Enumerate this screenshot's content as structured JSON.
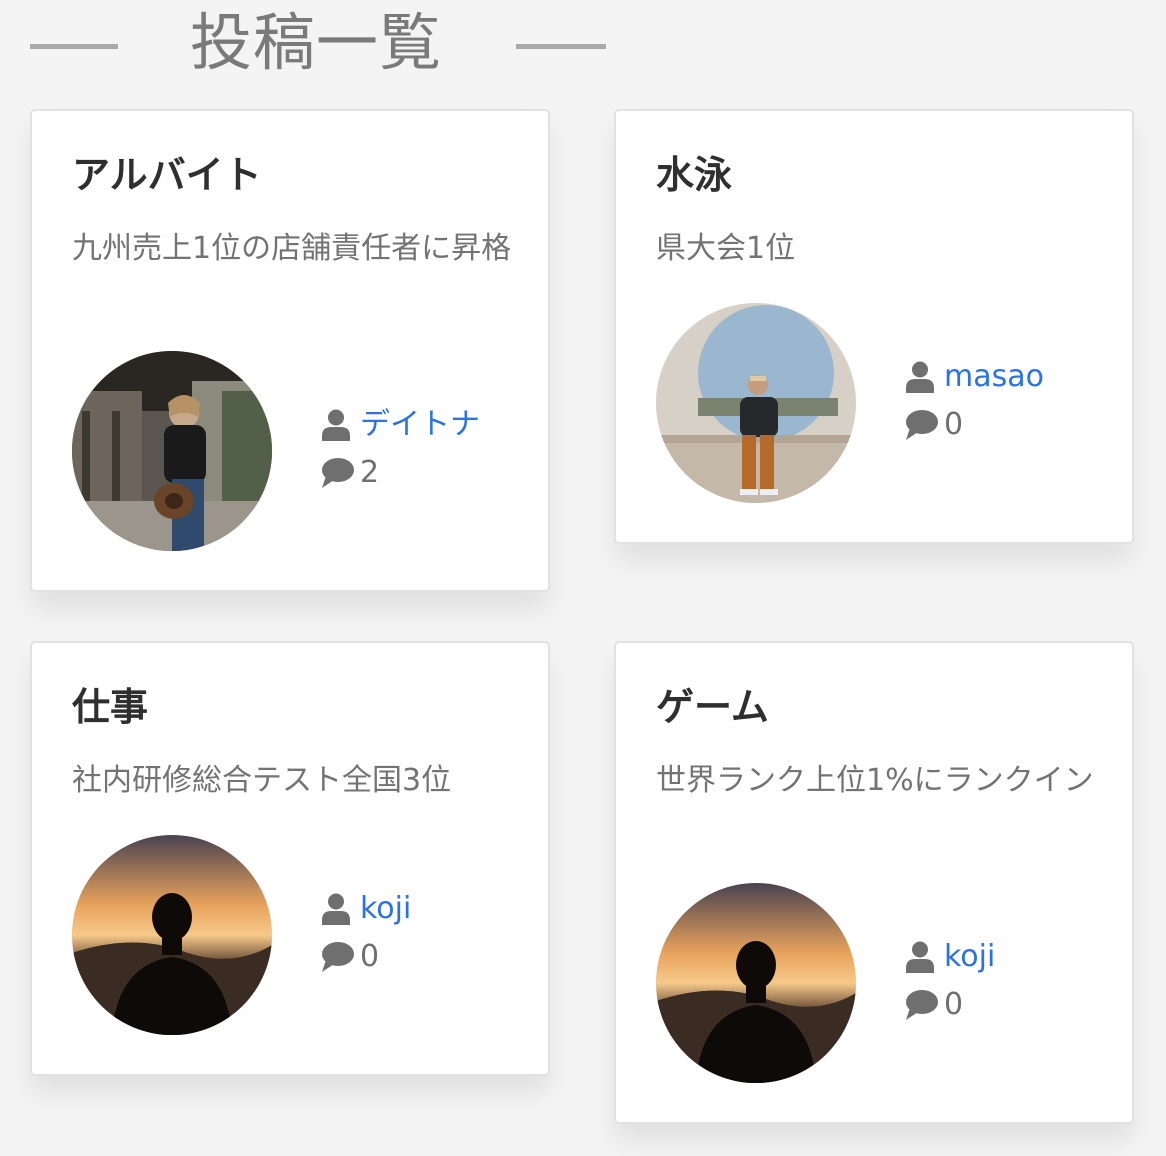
{
  "page": {
    "heading": "投稿一覧"
  },
  "posts": [
    {
      "title": "アルバイト",
      "description": "九州売上1位の店舗責任者に昇格",
      "author": "デイトナ",
      "comments": "2",
      "avatar_icon": "woman-with-hat-photo"
    },
    {
      "title": "水泳",
      "description": "県大会1位",
      "author": "masao",
      "comments": "0",
      "avatar_icon": "man-sitting-photo"
    },
    {
      "title": "仕事",
      "description": "社内研修総合テスト全国3位",
      "author": "koji",
      "comments": "0",
      "avatar_icon": "sunset-silhouette-photo"
    },
    {
      "title": "ゲーム",
      "description": "世界ランク上位1%にランクイン",
      "author": "koji",
      "comments": "0",
      "avatar_icon": "sunset-silhouette-photo"
    }
  ],
  "colors": {
    "link": "#2c72e4",
    "title": "#2f2f2f",
    "muted": "#737373"
  }
}
